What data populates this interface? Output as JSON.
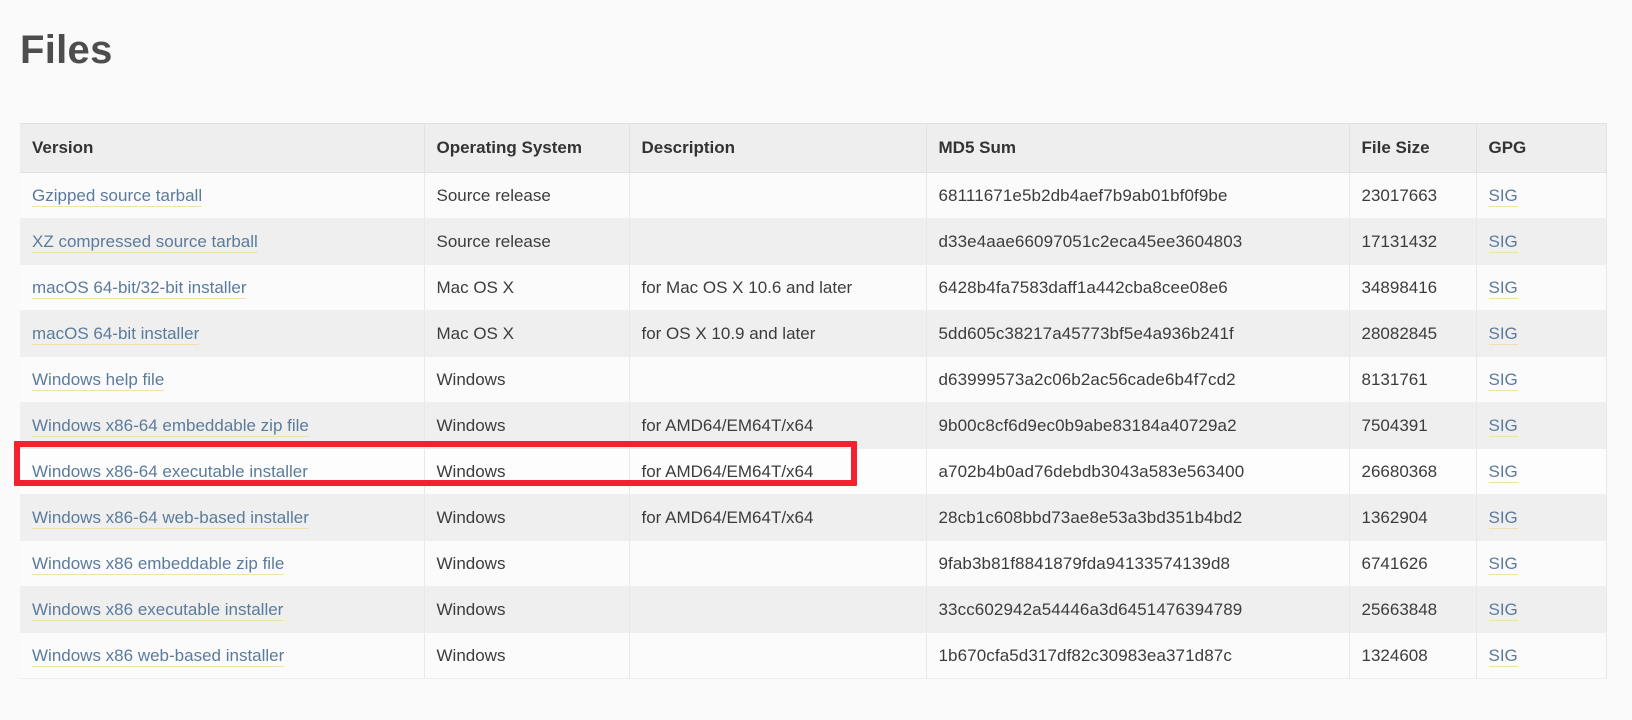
{
  "page": {
    "title": "Files",
    "background_color": "#fafafa",
    "link_color": "#5b7b9c",
    "highlight_color": "#f4212e"
  },
  "table": {
    "columns": [
      {
        "key": "version",
        "label": "Version"
      },
      {
        "key": "os",
        "label": "Operating System"
      },
      {
        "key": "description",
        "label": "Description"
      },
      {
        "key": "md5",
        "label": "MD5 Sum"
      },
      {
        "key": "filesize",
        "label": "File Size"
      },
      {
        "key": "gpg",
        "label": "GPG"
      }
    ],
    "gpg_link_label": "SIG",
    "rows": [
      {
        "version": "Gzipped source tarball",
        "os": "Source release",
        "description": "",
        "md5": "68111671e5b2db4aef7b9ab01bf0f9be",
        "filesize": "23017663",
        "gpg": "SIG",
        "highlighted": false
      },
      {
        "version": "XZ compressed source tarball",
        "os": "Source release",
        "description": "",
        "md5": "d33e4aae66097051c2eca45ee3604803",
        "filesize": "17131432",
        "gpg": "SIG",
        "highlighted": false
      },
      {
        "version": "macOS 64-bit/32-bit installer",
        "os": "Mac OS X",
        "description": "for Mac OS X 10.6 and later",
        "md5": "6428b4fa7583daff1a442cba8cee08e6",
        "filesize": "34898416",
        "gpg": "SIG",
        "highlighted": false
      },
      {
        "version": "macOS 64-bit installer",
        "os": "Mac OS X",
        "description": "for OS X 10.9 and later",
        "md5": "5dd605c38217a45773bf5e4a936b241f",
        "filesize": "28082845",
        "gpg": "SIG",
        "highlighted": false
      },
      {
        "version": "Windows help file",
        "os": "Windows",
        "description": "",
        "md5": "d63999573a2c06b2ac56cade6b4f7cd2",
        "filesize": "8131761",
        "gpg": "SIG",
        "highlighted": false
      },
      {
        "version": "Windows x86-64 embeddable zip file",
        "os": "Windows",
        "description": "for AMD64/EM64T/x64",
        "md5": "9b00c8cf6d9ec0b9abe83184a40729a2",
        "filesize": "7504391",
        "gpg": "SIG",
        "highlighted": false
      },
      {
        "version": "Windows x86-64 executable installer",
        "os": "Windows",
        "description": "for AMD64/EM64T/x64",
        "md5": "a702b4b0ad76debdb3043a583e563400",
        "filesize": "26680368",
        "gpg": "SIG",
        "highlighted": true
      },
      {
        "version": "Windows x86-64 web-based installer",
        "os": "Windows",
        "description": "for AMD64/EM64T/x64",
        "md5": "28cb1c608bbd73ae8e53a3bd351b4bd2",
        "filesize": "1362904",
        "gpg": "SIG",
        "highlighted": false
      },
      {
        "version": "Windows x86 embeddable zip file",
        "os": "Windows",
        "description": "",
        "md5": "9fab3b81f8841879fda94133574139d8",
        "filesize": "6741626",
        "gpg": "SIG",
        "highlighted": false
      },
      {
        "version": "Windows x86 executable installer",
        "os": "Windows",
        "description": "",
        "md5": "33cc602942a54446a3d6451476394789",
        "filesize": "25663848",
        "gpg": "SIG",
        "highlighted": false
      },
      {
        "version": "Windows x86 web-based installer",
        "os": "Windows",
        "description": "",
        "md5": "1b670cfa5d317df82c30983ea371d87c",
        "filesize": "1324608",
        "gpg": "SIG",
        "highlighted": false
      }
    ]
  }
}
